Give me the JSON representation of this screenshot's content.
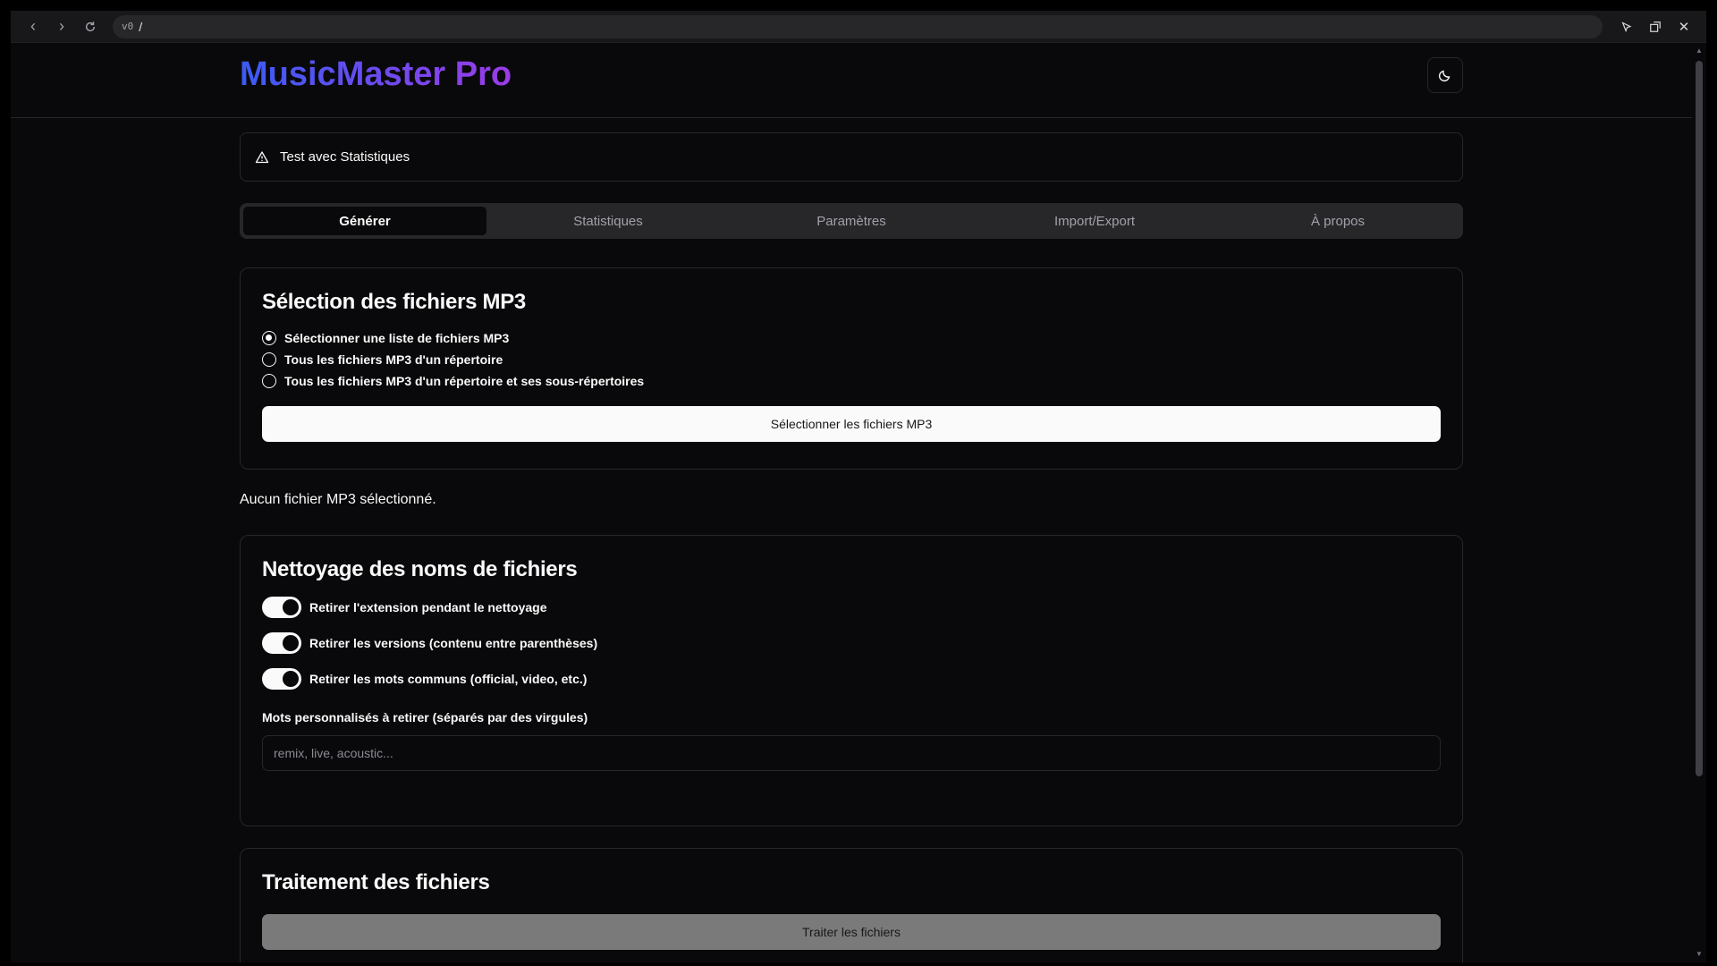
{
  "browser": {
    "address_prefix": "v0",
    "address": "/"
  },
  "app": {
    "title": "MusicMaster Pro"
  },
  "alert": {
    "text": "Test avec Statistiques"
  },
  "tabs": [
    {
      "label": "Générer",
      "active": true
    },
    {
      "label": "Statistiques",
      "active": false
    },
    {
      "label": "Paramètres",
      "active": false
    },
    {
      "label": "Import/Export",
      "active": false
    },
    {
      "label": "À propos",
      "active": false
    }
  ],
  "selection": {
    "title": "Sélection des fichiers MP3",
    "options": [
      {
        "label": "Sélectionner une liste de fichiers MP3",
        "checked": true
      },
      {
        "label": "Tous les fichiers MP3 d'un répertoire",
        "checked": false
      },
      {
        "label": "Tous les fichiers MP3 d'un répertoire et ses sous-répertoires",
        "checked": false
      }
    ],
    "button_label": "Sélectionner les fichiers MP3"
  },
  "status": {
    "text": "Aucun fichier MP3 sélectionné."
  },
  "cleaning": {
    "title": "Nettoyage des noms de fichiers",
    "toggles": [
      {
        "label": "Retirer l'extension pendant le nettoyage",
        "on": true
      },
      {
        "label": "Retirer les versions (contenu entre parenthèses)",
        "on": true
      },
      {
        "label": "Retirer les mots communs (official, video, etc.)",
        "on": true
      }
    ],
    "custom_words_label": "Mots personnalisés à retirer (séparés par des virgules)",
    "custom_words_value": "",
    "custom_words_placeholder": "remix, live, acoustic..."
  },
  "processing": {
    "title": "Traitement des fichiers",
    "button_label": "Traiter les fichiers"
  },
  "colors": {
    "background": "#09090b",
    "border": "#27272a",
    "gradient_start": "#3b5bf5",
    "gradient_end": "#9b3be8",
    "disabled_button": "#7a7a7a"
  }
}
